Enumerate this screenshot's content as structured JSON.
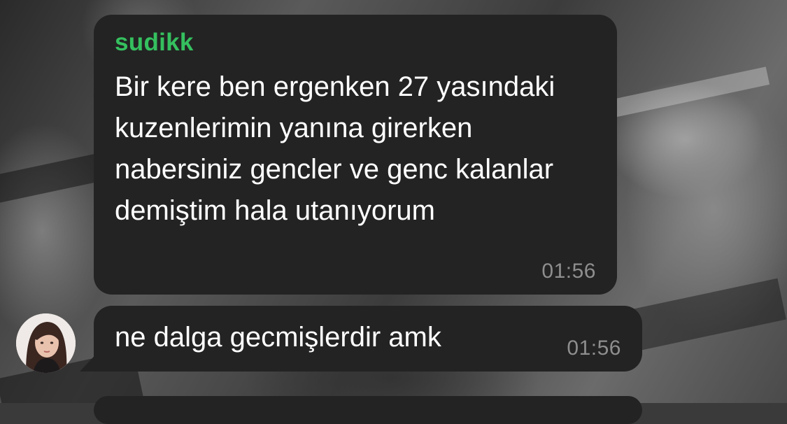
{
  "chat": {
    "messages": [
      {
        "sender": "sudikk",
        "text": "Bir kere ben ergenken 27 yasındaki kuzenlerimin yanına girerken nabersiniz gencler ve genc kalanlar demiştim hala utanıyorum",
        "time": "01:56"
      },
      {
        "text": "ne dalga gecmişlerdir amk",
        "time": "01:56"
      }
    ],
    "sender_color": "#35c05f"
  }
}
